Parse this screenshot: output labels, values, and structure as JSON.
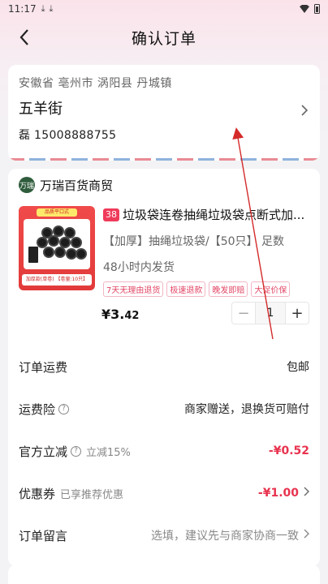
{
  "status_bar": {
    "time": "11:17",
    "icons": [
      "download-icon",
      "download-icon",
      "wifi-icon",
      "battery-icon"
    ]
  },
  "nav": {
    "title": "确认订单",
    "back_icon": "back-arrow-icon"
  },
  "address": {
    "region": "安徽省 亳州市 涡阳县 丹城镇",
    "street": "五羊街",
    "contact": "磊 15008888755"
  },
  "shop": {
    "name": "万瑞百货商贸",
    "logo_text": "万瑞"
  },
  "product": {
    "tag": "38",
    "title": "垃圾袋连卷抽绳垃圾袋点断式加...",
    "spec": "【加厚】抽绳垃圾袋/【50只】 足数",
    "ship": "48小时内发货",
    "badges": [
      "7天无理由退货",
      "极速退款",
      "晚发即赔",
      "大促价保"
    ],
    "price_int": "¥3.",
    "price_dec": "42",
    "qty": "1",
    "thumb_banner": "品质平口式",
    "thumb_strip": "加厚款(单卷) 【卷量:10只】"
  },
  "rows": {
    "shipping": {
      "label": "订单运费",
      "value": "包邮"
    },
    "insurance": {
      "label": "运费险",
      "value": "商家赠送，退换货可赔付"
    },
    "discount": {
      "label": "官方立减",
      "sub": "立减15%",
      "value": "-¥0.52"
    },
    "coupon": {
      "label": "优惠券",
      "sub": "已享推荐优惠",
      "value": "-¥1.00"
    },
    "message": {
      "label": "订单留言",
      "placeholder": "选填，建议先与商家协商一致"
    }
  },
  "colors": {
    "accent": "#e8334f",
    "badge": "#e24565",
    "annotation": "#d42a2a"
  }
}
